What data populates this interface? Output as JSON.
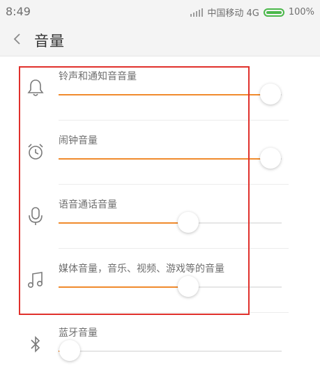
{
  "status_bar": {
    "time": "8:49",
    "carrier": "中国移动 4G",
    "battery": "100%",
    "battery_color": "#4bb84b"
  },
  "header": {
    "title": "音量",
    "back_icon": "chevron-left-icon"
  },
  "accent_color": "#f08a2c",
  "highlight_color": "#e0302b",
  "volume_rows": [
    {
      "label": "铃声和通知音音量",
      "icon": "bell-icon",
      "level": 0.95
    },
    {
      "label": "闹钟音量",
      "icon": "alarm-clock-icon",
      "level": 0.95
    },
    {
      "label": "语音通话音量",
      "icon": "microphone-icon",
      "level": 0.58
    },
    {
      "label": "媒体音量，音乐、视频、游戏等的音量",
      "icon": "music-note-icon",
      "level": 0.58
    },
    {
      "label": "蓝牙音量",
      "icon": "bluetooth-icon",
      "level": 0.05
    }
  ]
}
